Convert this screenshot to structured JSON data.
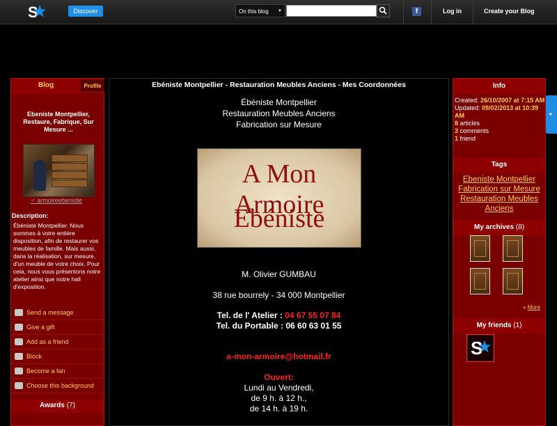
{
  "topbar": {
    "discover_label": "Discover",
    "search_scope": "On this blog",
    "search_placeholder": "",
    "login_label": "Log in",
    "create_label": "Create your Blog"
  },
  "left": {
    "blog_tab": "Blog",
    "profile_tab": "Profile",
    "title": "Ebeniste Montpellier, Restaure, Fabrique, Sur Mesure ...",
    "username": "armoireebeniste",
    "description_label": "Description:",
    "description": "Ébéniste Montpellier. Nous sommes à votre entière disposition, afin de restaurer vos meubles de famille. Mais aussi, dans la réalisation, sur mesure, d'un meuble de votre choix. Pour cela, nous vous présentons notre atelier ainsi que notre hall d'exposition.",
    "actions": [
      "Send a message",
      "Give a gift",
      "Add as a friend",
      "Block",
      "Become a fan",
      "Choose this background"
    ],
    "awards_label": "Awards",
    "awards_count": "(7)"
  },
  "main": {
    "header": "Ebéniste Montpellier - Restauration Meubles Anciens - Mes Coordonnées",
    "lines": [
      "Ébéniste Montpellier",
      "Restauration Meubles Anciens",
      "Fabrication sur Mesure"
    ],
    "banner_line1": "A Mon Armoire",
    "banner_line2": "Ebéniste",
    "name": "M. Olivier GUMBAU",
    "address": "38  rue  bourrely  -  34 000 Montpellier",
    "tel_atelier_label": "Tel. de l' Atelier :",
    "tel_atelier": "04 67 55 07 84",
    "tel_portable": "Tel. du Portable : 06 60 63 01 55",
    "email": "a-mon-armoire@hotmail.fr",
    "open_label": "Ouvert:",
    "hours": [
      "Lundi au Vendredi,",
      "de 9 h. à 12 h.,",
      "de 14 h. à 19 h."
    ]
  },
  "right": {
    "info_head": "Info",
    "created_label": "Created:",
    "created": "26/10/2007 at 7:15 AM",
    "updated_label": "Updated:",
    "updated": "09/02/2013 at 10:39 AM",
    "articles_n": "8",
    "articles_label": "articles",
    "comments_n": "3",
    "comments_label": "comments",
    "friend_n": "1",
    "friend_label": "friend",
    "tags_head": "Tags",
    "tags": [
      "Ebeniste Montpellier",
      "Fabrication sur Mesure",
      "Restauration Meubles",
      "Anciens"
    ],
    "archives_head": "My archives",
    "archives_count": "(8)",
    "more_label": "More",
    "friends_head": "My friends",
    "friends_count": "(1)"
  },
  "colors": {
    "panel": "#7a0000",
    "accent_yellow": "#ffcc55",
    "accent_red": "#ff2020",
    "blue": "#1e90e8"
  }
}
